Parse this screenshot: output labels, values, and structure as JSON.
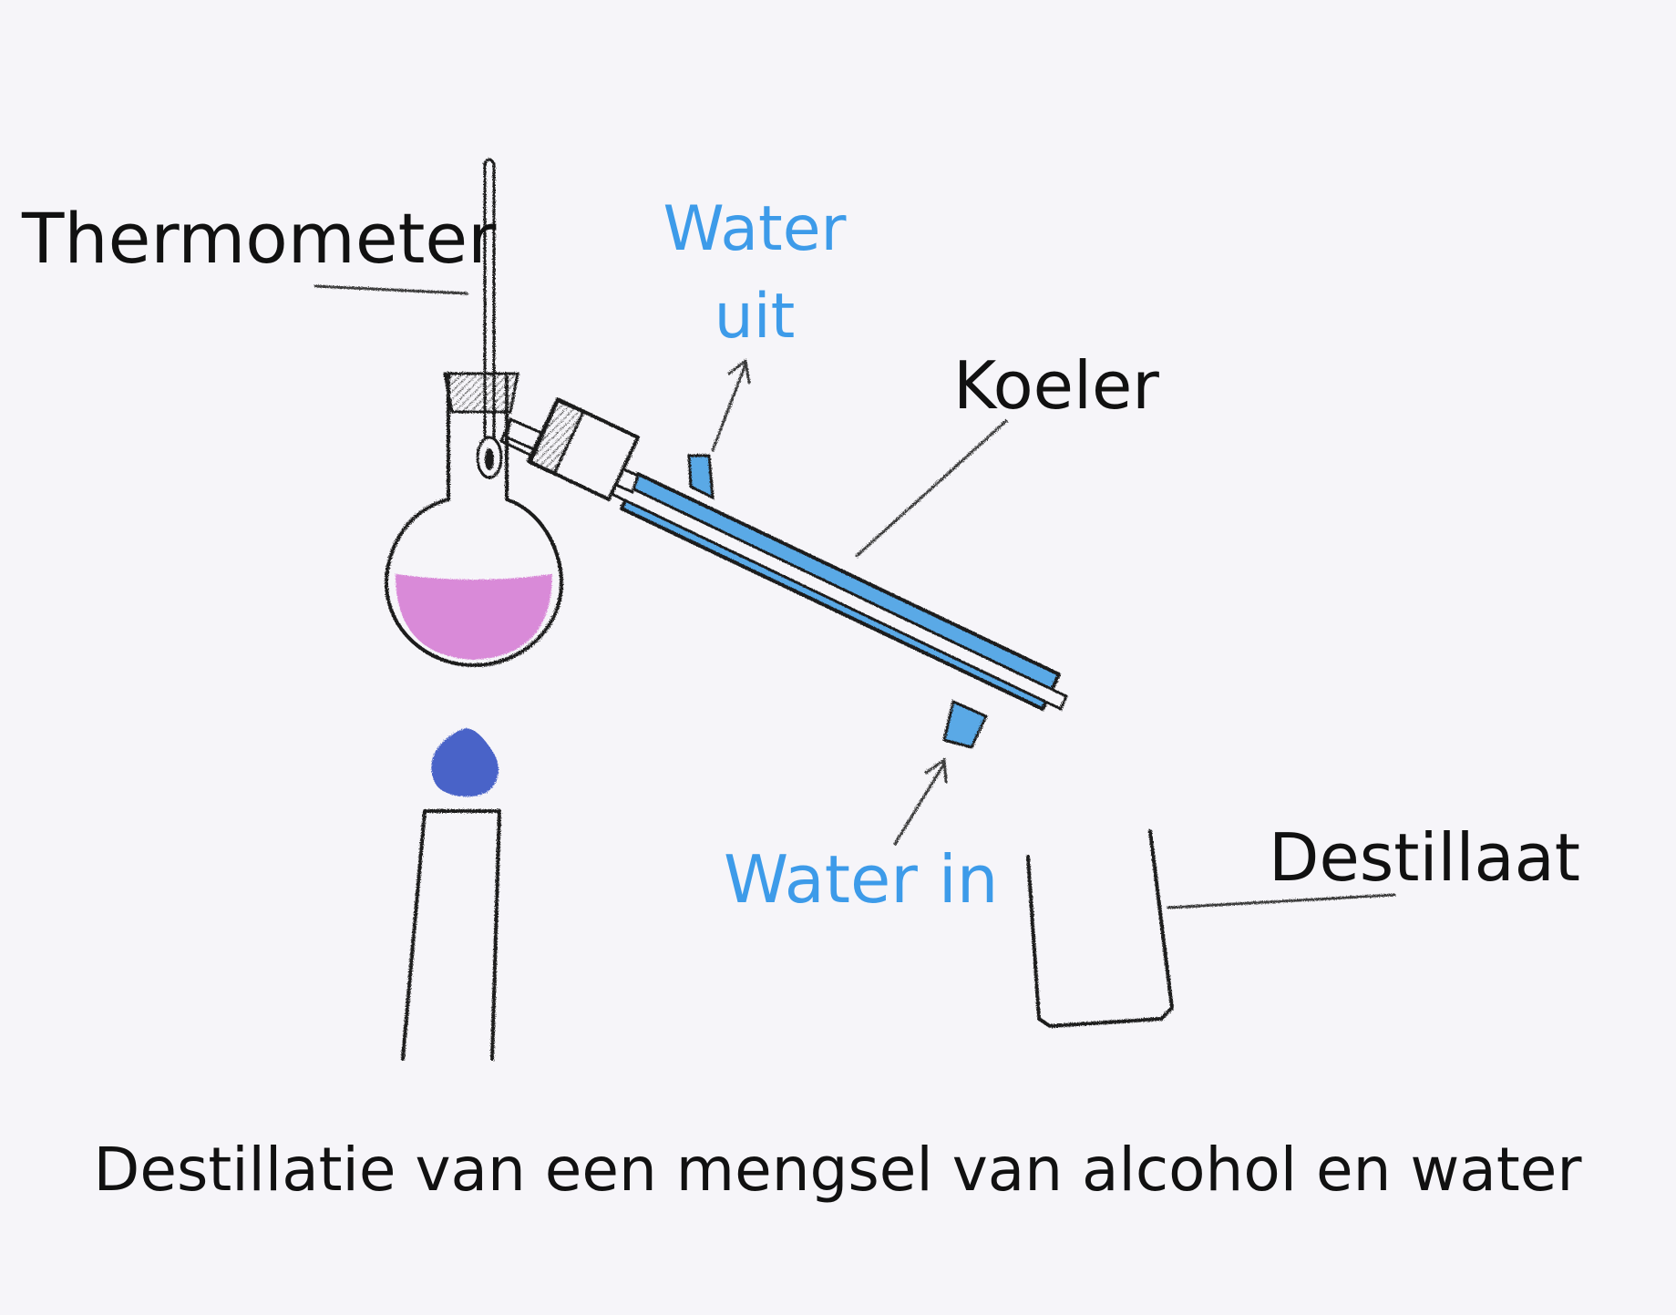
{
  "labels": {
    "thermometer": "Thermometer",
    "water_out_line1": "Water",
    "water_out_line2": "uit",
    "condenser": "Koeler",
    "water_in": "Water in",
    "distillate": "Destillaat",
    "caption": "Destillatie van een mengsel van alcohol en water"
  },
  "colors": {
    "background": "#f6f5f9",
    "water_label": "#3d9be9",
    "coolant": "#5aa9e6",
    "liquid": "#d98ad8",
    "flame": "#4a63c8",
    "ink": "#1a1a1a"
  },
  "icons": {
    "flask": "round-bottom-flask-icon",
    "thermometer": "thermometer-icon",
    "condenser": "liebig-condenser-icon",
    "burner": "burner-flame-icon",
    "beaker": "collection-beaker-icon"
  }
}
